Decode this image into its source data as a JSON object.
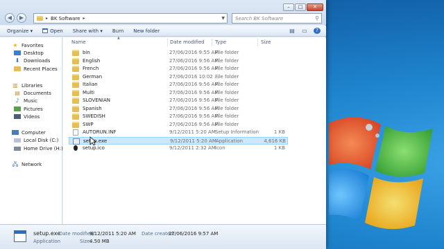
{
  "window": {
    "address": {
      "path": "BK Software",
      "arrow": "▸"
    },
    "search_placeholder": "Search BK Software",
    "controls": {
      "minimize": "–",
      "maximize": "□",
      "close": "✕"
    },
    "nav": {
      "back": "◀",
      "forward": "▶"
    }
  },
  "toolbar": {
    "organize": "Organize ▾",
    "open": "Open",
    "share_with": "Share with ▾",
    "burn": "Burn",
    "new_folder": "New folder"
  },
  "navpane": {
    "favorites": "Favorites",
    "desktop": "Desktop",
    "downloads": "Downloads",
    "recent_places": "Recent Places",
    "libraries": "Libraries",
    "documents": "Documents",
    "music": "Music",
    "pictures": "Pictures",
    "videos": "Videos",
    "computer": "Computer",
    "local_disk": "Local Disk (C:)",
    "home_drive": "Home Drive (H:)",
    "network": "Network"
  },
  "columns": {
    "name": "Name",
    "date": "Date modified",
    "type": "Type",
    "size": "Size"
  },
  "files": [
    {
      "name": "bin",
      "date": "27/06/2016 9:55 AM",
      "type": "File folder",
      "size": "",
      "kind": "folder"
    },
    {
      "name": "English",
      "date": "27/06/2016 9:56 AM",
      "type": "File folder",
      "size": "",
      "kind": "folder"
    },
    {
      "name": "French",
      "date": "27/06/2016 9:56 AM",
      "type": "File folder",
      "size": "",
      "kind": "folder"
    },
    {
      "name": "German",
      "date": "27/06/2016 10:02 ...",
      "type": "File folder",
      "size": "",
      "kind": "folder"
    },
    {
      "name": "Italian",
      "date": "27/06/2016 9:56 AM",
      "type": "File folder",
      "size": "",
      "kind": "folder"
    },
    {
      "name": "Multi",
      "date": "27/06/2016 9:56 AM",
      "type": "File folder",
      "size": "",
      "kind": "folder"
    },
    {
      "name": "SLOVENIAN",
      "date": "27/06/2016 9:56 AM",
      "type": "File folder",
      "size": "",
      "kind": "folder"
    },
    {
      "name": "Spanish",
      "date": "27/06/2016 9:56 AM",
      "type": "File folder",
      "size": "",
      "kind": "folder"
    },
    {
      "name": "SWEDISH",
      "date": "27/06/2016 9:56 AM",
      "type": "File folder",
      "size": "",
      "kind": "folder"
    },
    {
      "name": "SWP",
      "date": "27/06/2016 9:56 AM",
      "type": "File folder",
      "size": "",
      "kind": "folder"
    },
    {
      "name": "AUTORUN.INF",
      "date": "9/12/2011 5:20 AM",
      "type": "Setup Information",
      "size": "1 KB",
      "kind": "doc"
    },
    {
      "name": "setup.exe",
      "date": "9/12/2011 5:20 AM",
      "type": "Application",
      "size": "4,616 KB",
      "kind": "exe",
      "selected": true
    },
    {
      "name": "setup.ico",
      "date": "9/12/2011 2:32 AM",
      "type": "Icon",
      "size": "1 KB",
      "kind": "ico"
    }
  ],
  "details": {
    "filename": "setup.exe",
    "filetype": "Application",
    "date_modified_label": "Date modified:",
    "date_modified": "9/12/2011 5:20 AM",
    "date_created_label": "Date created:",
    "date_created": "27/06/2016 9:57 AM",
    "size_label": "Size:",
    "size": "4.50 MB"
  },
  "colors": {
    "selection": "#cce8ff",
    "folder": "#e6be57",
    "desktop": "#1f86cf"
  }
}
